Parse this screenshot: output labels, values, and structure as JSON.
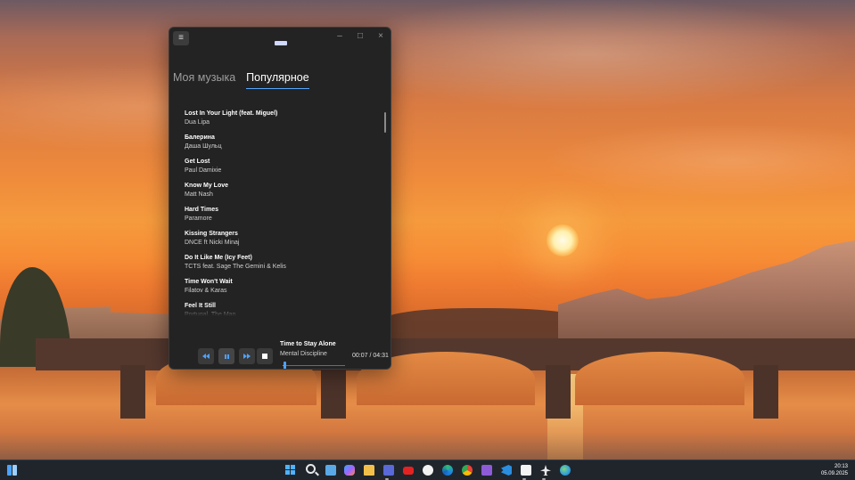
{
  "window": {
    "menu_icon": "hamburger-menu-icon",
    "controls": {
      "minimize": "–",
      "maximize": "□",
      "close": "×"
    }
  },
  "tabs": [
    {
      "label": "Моя музыка",
      "active": false
    },
    {
      "label": "Популярное",
      "active": true
    }
  ],
  "tracks": [
    {
      "title": "Lost In Your Light (feat. Miguel)",
      "artist": "Dua Lipa"
    },
    {
      "title": "Балерина",
      "artist": "Даша Шульц"
    },
    {
      "title": "Get Lost",
      "artist": "Paul Damixie"
    },
    {
      "title": "Know My Love",
      "artist": "Matt Nash"
    },
    {
      "title": "Hard Times",
      "artist": "Paramore"
    },
    {
      "title": "Kissing Strangers",
      "artist": "DNCE ft Nicki Minaj"
    },
    {
      "title": "Do It Like Me (Icy Feet)",
      "artist": "TCTS feat. Sage The Gemini & Kelis"
    },
    {
      "title": "Time Won't Wait",
      "artist": "Filatov & Karas"
    },
    {
      "title": "Feel It Still",
      "artist": "Portugal. The Man"
    }
  ],
  "player": {
    "now_playing_title": "Time to Stay Alone",
    "now_playing_artist": "Mental Discipline",
    "time": "00:07 / 04:31",
    "progress_fraction": 0.027,
    "buttons": [
      "previous-icon",
      "pause-icon",
      "next-icon",
      "stop-icon"
    ],
    "accent_color": "#4ea1ff"
  },
  "taskbar": {
    "icons": [
      "start-icon",
      "search-icon",
      "notes-icon",
      "copilot-icon",
      "file-explorer-icon",
      "save-icon",
      "youtube-icon",
      "yandex-browser-icon",
      "edge-icon",
      "chrome-icon",
      "visual-studio-icon",
      "vscode-icon",
      "notepad-icon",
      "plane-app-icon",
      "globe-icon"
    ],
    "clock_time": "20:13",
    "clock_date": "05.09.2025"
  }
}
